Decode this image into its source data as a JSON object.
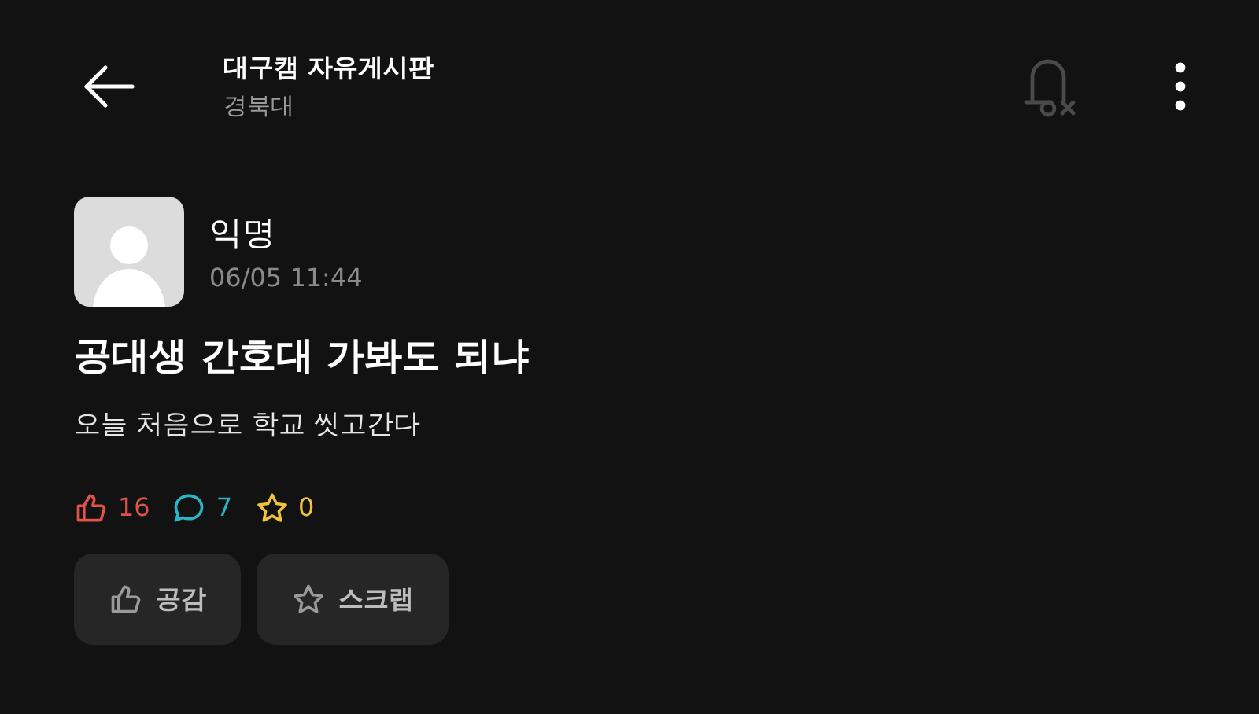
{
  "header": {
    "title": "대구캠 자유게시판",
    "subtitle": "경북대"
  },
  "post": {
    "author": "익명",
    "date": "06/05 11:44",
    "title": "공대생 간호대 가봐도 되냐",
    "body": "오늘 처음으로 학교 씻고간다"
  },
  "stats": [
    {
      "kind": "like",
      "count": "16",
      "color": "#e0534a"
    },
    {
      "kind": "comment",
      "count": "7",
      "color": "#2bb5c4"
    },
    {
      "kind": "scrap",
      "count": "0",
      "color": "#f0c23b"
    }
  ],
  "buttons": [
    {
      "kind": "like",
      "label": "공감"
    },
    {
      "kind": "scrap",
      "label": "스크랩"
    }
  ]
}
